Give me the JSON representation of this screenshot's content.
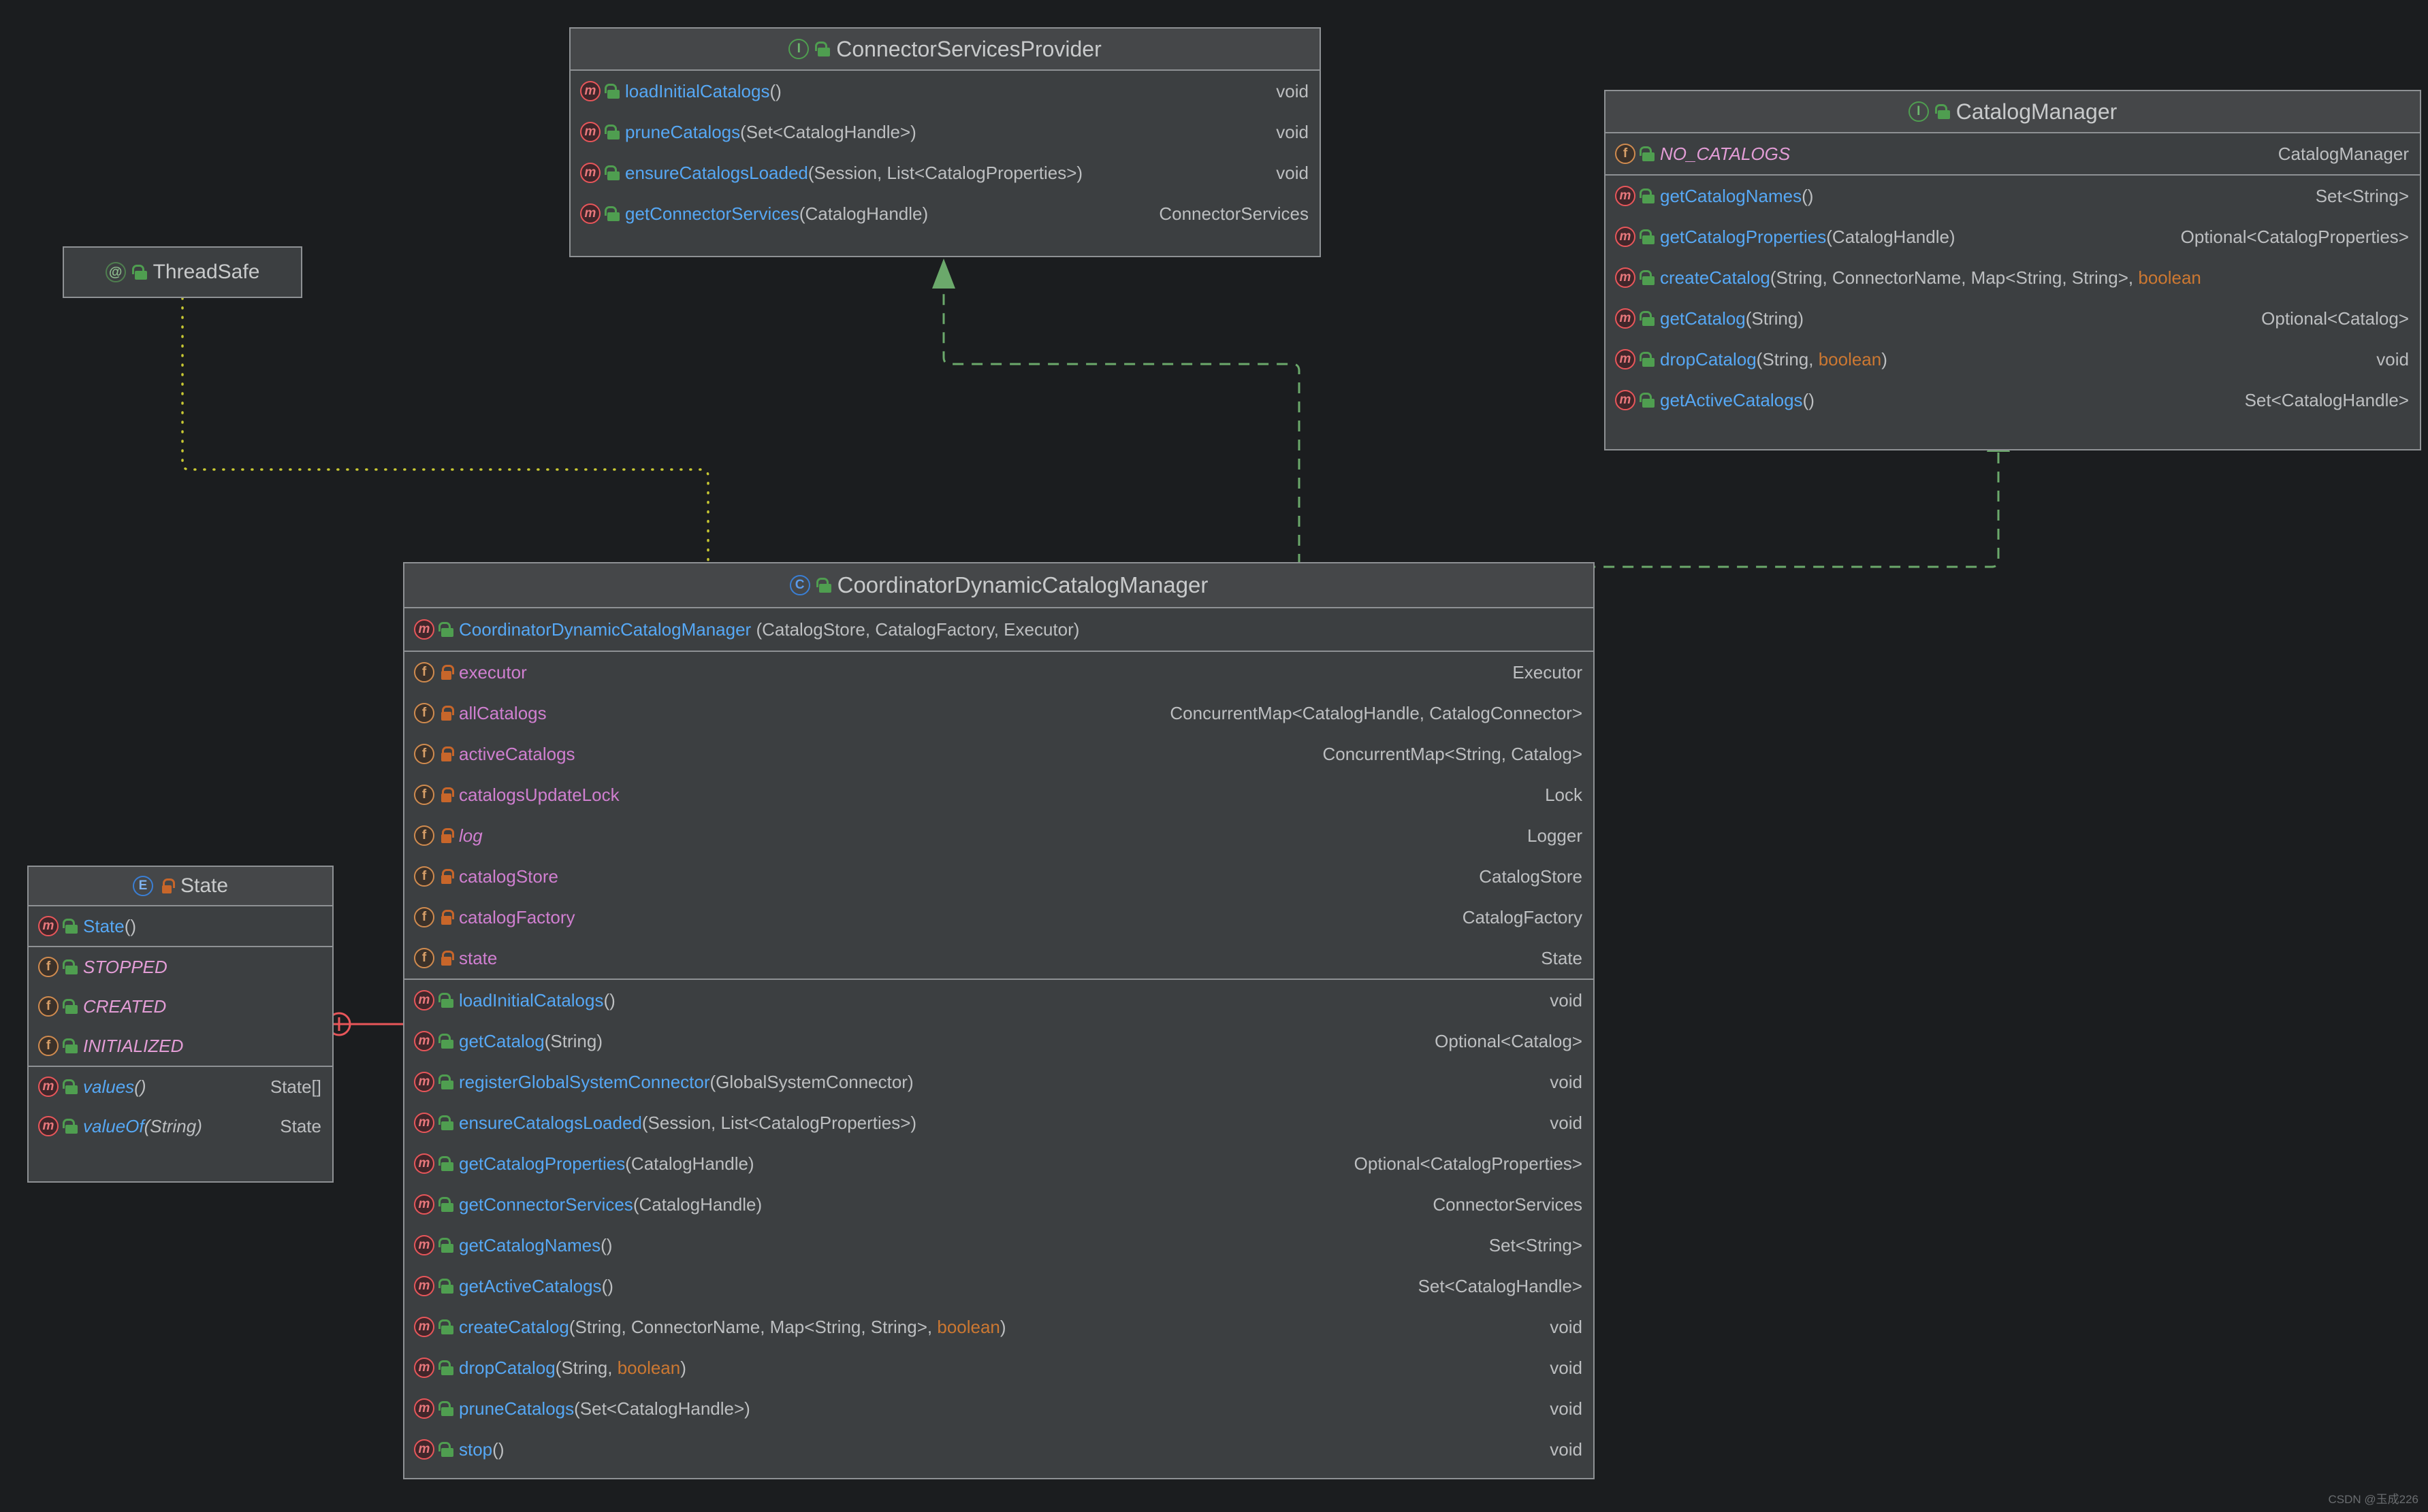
{
  "diagram": {
    "title": "UML class diagram",
    "watermark": "CSDN @玉成226",
    "colors": {
      "background": "#1b1d1f",
      "box_fill": "#3c3f41",
      "box_header": "#454749",
      "box_border": "#8e9194",
      "method_name": "#56a8f5",
      "field_name": "#d07fd0",
      "keyword": "#cc7832",
      "text": "#bdbfc1",
      "inherit_arrow": "#6ba96b",
      "annotation_link": "#c8c832",
      "inner_class_link": "#e8565a"
    }
  },
  "annotation_box": {
    "name": "ThreadSafe",
    "icon": "annotation-icon",
    "lock": "open-lock-icon"
  },
  "connector_services_provider": {
    "name": "ConnectorServicesProvider",
    "stereotype": "interface",
    "icon": "interface-icon",
    "lock": "open-lock-icon",
    "methods": [
      {
        "icon": "method-icon",
        "lock": "open-lock-icon",
        "name": "loadInitialCatalogs",
        "params": "()",
        "ret": "void",
        "ret_kw": true
      },
      {
        "icon": "method-icon",
        "lock": "open-lock-icon",
        "name": "pruneCatalogs",
        "params": "(Set<CatalogHandle>)",
        "ret": "void",
        "ret_kw": true
      },
      {
        "icon": "method-icon",
        "lock": "open-lock-icon",
        "name": "ensureCatalogsLoaded",
        "params": "(Session, List<CatalogProperties>)",
        "ret": "void",
        "ret_kw": true
      },
      {
        "icon": "method-icon",
        "lock": "open-lock-icon",
        "name": "getConnectorServices",
        "params": "(CatalogHandle)",
        "ret": "ConnectorServices",
        "ret_kw": false
      }
    ]
  },
  "catalog_manager": {
    "name": "CatalogManager",
    "stereotype": "interface",
    "icon": "interface-icon",
    "lock": "open-lock-icon",
    "fields": [
      {
        "icon": "field-icon",
        "lock": "open-lock-icon",
        "name": "NO_CATALOGS",
        "italic": true,
        "ret": "CatalogManager"
      }
    ],
    "methods": [
      {
        "icon": "method-icon",
        "lock": "open-lock-icon",
        "name": "getCatalogNames",
        "params": "()",
        "ret": "Set<String>",
        "ret_kw": false
      },
      {
        "icon": "method-icon",
        "lock": "open-lock-icon",
        "name": "getCatalogProperties",
        "params": "(CatalogHandle)",
        "ret": "Optional<CatalogProperties>",
        "ret_kw": false
      },
      {
        "icon": "method-icon",
        "lock": "open-lock-icon",
        "name": "createCatalog",
        "params": "(String, ConnectorName, Map<String, String>, boolean)",
        "params_kw": "boolean",
        "ret": "",
        "ret_kw": false
      },
      {
        "icon": "method-icon",
        "lock": "open-lock-icon",
        "name": "getCatalog",
        "params": "(String)",
        "ret": "Optional<Catalog>",
        "ret_kw": false
      },
      {
        "icon": "method-icon",
        "lock": "open-lock-icon",
        "name": "dropCatalog",
        "params": "(String, boolean)",
        "params_kw": "boolean",
        "ret": "void",
        "ret_kw": true
      },
      {
        "icon": "method-icon",
        "lock": "open-lock-icon",
        "name": "getActiveCatalogs",
        "params": "()",
        "ret": "Set<CatalogHandle>",
        "ret_kw": false
      }
    ]
  },
  "coordinator": {
    "name": "CoordinatorDynamicCatalogManager",
    "stereotype": "class",
    "icon": "class-icon",
    "lock": "open-lock-icon",
    "constructors": [
      {
        "icon": "method-icon",
        "lock": "open-lock-icon",
        "name": "CoordinatorDynamicCatalogManager",
        "params": "(CatalogStore, CatalogFactory, Executor)",
        "ret": ""
      }
    ],
    "fields": [
      {
        "icon": "field-icon",
        "lock": "closed-lock-icon",
        "name": "executor",
        "italic": false,
        "ret": "Executor"
      },
      {
        "icon": "field-icon",
        "lock": "closed-lock-icon",
        "name": "allCatalogs",
        "italic": false,
        "ret": "ConcurrentMap<CatalogHandle, CatalogConnector>"
      },
      {
        "icon": "field-icon",
        "lock": "closed-lock-icon",
        "name": "activeCatalogs",
        "italic": false,
        "ret": "ConcurrentMap<String, Catalog>"
      },
      {
        "icon": "field-icon",
        "lock": "closed-lock-icon",
        "name": "catalogsUpdateLock",
        "italic": false,
        "ret": "Lock"
      },
      {
        "icon": "field-icon",
        "lock": "closed-lock-icon",
        "name": "log",
        "italic": true,
        "ret": "Logger"
      },
      {
        "icon": "field-icon",
        "lock": "closed-lock-icon",
        "name": "catalogStore",
        "italic": false,
        "ret": "CatalogStore"
      },
      {
        "icon": "field-icon",
        "lock": "closed-lock-icon",
        "name": "catalogFactory",
        "italic": false,
        "ret": "CatalogFactory"
      },
      {
        "icon": "field-icon",
        "lock": "closed-lock-icon",
        "name": "state",
        "italic": false,
        "ret": "State"
      }
    ],
    "methods": [
      {
        "icon": "method-icon",
        "lock": "open-lock-icon",
        "name": "loadInitialCatalogs",
        "params": "()",
        "ret": "void",
        "ret_kw": true
      },
      {
        "icon": "method-icon",
        "lock": "open-lock-icon",
        "name": "getCatalog",
        "params": "(String)",
        "ret": "Optional<Catalog>",
        "ret_kw": false
      },
      {
        "icon": "method-icon",
        "lock": "open-lock-icon",
        "name": "registerGlobalSystemConnector",
        "params": "(GlobalSystemConnector)",
        "ret": "void",
        "ret_kw": true
      },
      {
        "icon": "method-icon",
        "lock": "open-lock-icon",
        "name": "ensureCatalogsLoaded",
        "params": "(Session, List<CatalogProperties>)",
        "ret": "void",
        "ret_kw": true
      },
      {
        "icon": "method-icon",
        "lock": "open-lock-icon",
        "name": "getCatalogProperties",
        "params": "(CatalogHandle)",
        "ret": "Optional<CatalogProperties>",
        "ret_kw": false
      },
      {
        "icon": "method-icon",
        "lock": "open-lock-icon",
        "name": "getConnectorServices",
        "params": "(CatalogHandle)",
        "ret": "ConnectorServices",
        "ret_kw": false
      },
      {
        "icon": "method-icon",
        "lock": "open-lock-icon",
        "name": "getCatalogNames",
        "params": "()",
        "ret": "Set<String>",
        "ret_kw": false
      },
      {
        "icon": "method-icon",
        "lock": "open-lock-icon",
        "name": "getActiveCatalogs",
        "params": "()",
        "ret": "Set<CatalogHandle>",
        "ret_kw": false
      },
      {
        "icon": "method-icon",
        "lock": "open-lock-icon",
        "name": "createCatalog",
        "params": "(String, ConnectorName, Map<String, String>, boolean)",
        "params_kw": "boolean",
        "ret": "void",
        "ret_kw": true
      },
      {
        "icon": "method-icon",
        "lock": "open-lock-icon",
        "name": "dropCatalog",
        "params": "(String, boolean)",
        "params_kw": "boolean",
        "ret": "void",
        "ret_kw": true
      },
      {
        "icon": "method-icon",
        "lock": "open-lock-icon",
        "name": "pruneCatalogs",
        "params": "(Set<CatalogHandle>)",
        "ret": "void",
        "ret_kw": true
      },
      {
        "icon": "method-icon",
        "lock": "open-lock-icon",
        "name": "stop",
        "params": "()",
        "ret": "void",
        "ret_kw": true
      }
    ]
  },
  "state_enum": {
    "name": "State",
    "stereotype": "enum",
    "icon": "enum-icon",
    "lock": "closed-lock-icon",
    "constructors": [
      {
        "icon": "method-icon",
        "lock": "open-lock-icon",
        "name": "State",
        "params": "()",
        "ret": ""
      }
    ],
    "constants": [
      {
        "icon": "field-icon",
        "lock": "open-lock-icon",
        "name": "STOPPED",
        "italic": true,
        "ret": ""
      },
      {
        "icon": "field-icon",
        "lock": "open-lock-icon",
        "name": "CREATED",
        "italic": true,
        "ret": ""
      },
      {
        "icon": "field-icon",
        "lock": "open-lock-icon",
        "name": "INITIALIZED",
        "italic": true,
        "ret": ""
      }
    ],
    "methods": [
      {
        "icon": "method-icon",
        "lock": "open-lock-icon",
        "name": "values",
        "params": "()",
        "ret": "State[]",
        "italic": true
      },
      {
        "icon": "method-icon",
        "lock": "open-lock-icon",
        "name": "valueOf",
        "params": "(String)",
        "ret": "State",
        "italic": true
      }
    ]
  },
  "relations": [
    {
      "from": "CoordinatorDynamicCatalogManager",
      "to": "ConnectorServicesProvider",
      "type": "realization",
      "style": "dashed-green-arrow"
    },
    {
      "from": "CoordinatorDynamicCatalogManager",
      "to": "CatalogManager",
      "type": "realization",
      "style": "dashed-green-arrow"
    },
    {
      "from": "ThreadSafe",
      "to": "CoordinatorDynamicCatalogManager",
      "type": "annotation",
      "style": "dotted-yellow"
    },
    {
      "from": "CoordinatorDynamicCatalogManager",
      "to": "State",
      "type": "inner-class",
      "style": "solid-red-plus"
    }
  ]
}
